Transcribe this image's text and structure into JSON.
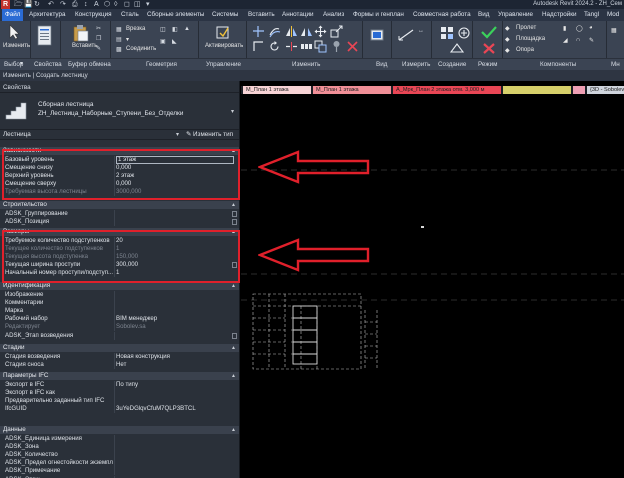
{
  "window": {
    "title": "Autodesk Revit 2024.2 - ZH_Сем",
    "logo_letter": "R"
  },
  "ribbon_tabs": [
    "Файл",
    "Архитектура",
    "Конструкция",
    "Сталь",
    "Сборные элементы",
    "Системы",
    "Вставить",
    "Аннотации",
    "Анализ",
    "Формы и генплан",
    "Совместная работа",
    "Вид",
    "Управление",
    "Надстройки",
    "Tangl",
    "Mod"
  ],
  "ribbon": {
    "modify_label": "Изменить",
    "paste_label": "Вставить",
    "cut_label": "Врезка",
    "join_label": "Соединить",
    "activate_label": "Активировать",
    "span_label": "Пролет",
    "area_label": "Площадка",
    "support_label": "Опора"
  },
  "ribbon_groups": [
    "Выбор",
    "Свойства",
    "Буфер обмена",
    "Геометрия",
    "Управление",
    "Изменить",
    "Вид",
    "Измерить",
    "Создание",
    "Режим",
    "Компоненты",
    "Мн"
  ],
  "context_bar": "Изменить | Создать лестницу",
  "properties": {
    "header": "Свойства",
    "type_line1": "Сборная лестница",
    "type_line2": "ZH_Лестница_Наборные_Ступени_Без_Отделки",
    "filter_label": "Лестница",
    "edit_type_label": "Изменить тип",
    "sections": [
      {
        "title": "Зависимости",
        "rows": [
          {
            "k": "Базовый уровень",
            "v": "1 этаж",
            "dim": false
          },
          {
            "k": "Смещение снизу",
            "v": "0,000",
            "dim": false
          },
          {
            "k": "Верхний уровень",
            "v": "2 этаж",
            "dim": false
          },
          {
            "k": "Смещение сверху",
            "v": "0,000",
            "dim": false
          },
          {
            "k": "Требуемая высота лестницы",
            "v": "3000,000",
            "dim": true
          }
        ]
      },
      {
        "title": "Строительство",
        "rows": [
          {
            "k": "ADSK_Группирование",
            "v": "",
            "dim": false,
            "cb": true
          },
          {
            "k": "ADSK_Позиция",
            "v": "",
            "dim": false,
            "cb": true
          }
        ]
      },
      {
        "title": "Размеры",
        "rows": [
          {
            "k": "Требуемое количество подступенков",
            "v": "20",
            "dim": false
          },
          {
            "k": "Текущее количество подступенков",
            "v": "1",
            "dim": true
          },
          {
            "k": "Текущая высота подступенка",
            "v": "150,000",
            "dim": true
          },
          {
            "k": "Текущая ширина проступи",
            "v": "300,000",
            "dim": false,
            "cb": true
          },
          {
            "k": "Начальный номер проступи/подступ...",
            "v": "1",
            "dim": false
          }
        ]
      },
      {
        "title": "Идентификация",
        "rows": [
          {
            "k": "Изображение",
            "v": "",
            "dim": false
          },
          {
            "k": "Комментарии",
            "v": "",
            "dim": false
          },
          {
            "k": "Марка",
            "v": "",
            "dim": false
          },
          {
            "k": "Рабочий набор",
            "v": "BIM менеджер",
            "dim": false
          },
          {
            "k": "Редактирует",
            "v": "Sobolev.sa",
            "dim": true
          },
          {
            "k": "ADSK_Этап возведения",
            "v": "",
            "dim": false,
            "cb": true
          }
        ]
      },
      {
        "title": "Стадии",
        "rows": [
          {
            "k": "Стадия возведения",
            "v": "Новая конструкция",
            "dim": false
          },
          {
            "k": "Стадия сноса",
            "v": "Нет",
            "dim": false
          }
        ]
      },
      {
        "title": "Параметры IFC",
        "rows": [
          {
            "k": "Экспорт в IFC",
            "v": "По типу",
            "dim": false
          },
          {
            "k": "Экспорт в IFC как",
            "v": "",
            "dim": false
          },
          {
            "k": "Предварительно заданный тип IFC",
            "v": "",
            "dim": false
          },
          {
            "k": "IfcGUID",
            "v": "3uYeDGlqvCfuM7QLP3BTCL",
            "dim": false
          }
        ]
      },
      {
        "title": "Данные",
        "rows": [
          {
            "k": "ADSK_Единица измерения",
            "v": "",
            "dim": false
          },
          {
            "k": "ADSK_Зона",
            "v": "",
            "dim": false
          },
          {
            "k": "ADSK_Количество",
            "v": "",
            "dim": false
          },
          {
            "k": "ADSK_Предел огнестойкости экземпл...",
            "v": "",
            "dim": false
          },
          {
            "k": "ADSK_Примечание",
            "v": "",
            "dim": false
          },
          {
            "k": "ADSK_Этаж",
            "v": "",
            "dim": false
          }
        ]
      }
    ]
  },
  "view_tabs": [
    {
      "label": "М_План 1 этажа",
      "color": "#f7d3d5",
      "active": true
    },
    {
      "label": "М_План 1 этажа",
      "color": "#f08f97",
      "active": false
    },
    {
      "label": "А_Мрк_План 2 этажа отм. 3,000 м",
      "color": "#e94655",
      "active": false
    },
    {
      "label": "",
      "color": "#d6cf6a",
      "active": false
    },
    {
      "label": "",
      "color": "#ef9fb4",
      "active": false
    },
    {
      "label": "{3D - Sobolev",
      "color": "#cfd4dc",
      "active": false
    }
  ],
  "colors": {
    "annotation_red": "#e0202b",
    "accent_blue": "#2a6bd4"
  }
}
